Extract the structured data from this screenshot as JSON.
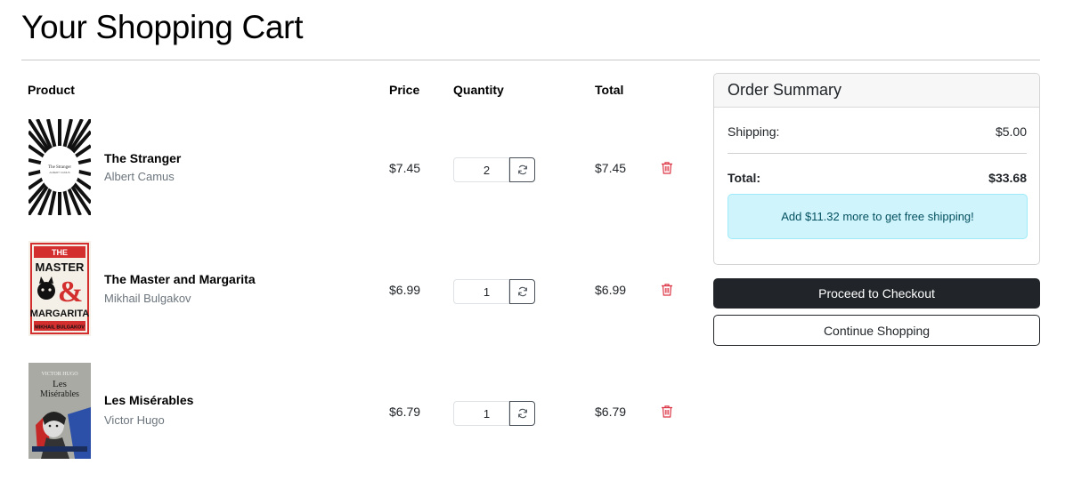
{
  "page": {
    "title": "Your Shopping Cart"
  },
  "table": {
    "headers": {
      "product": "Product",
      "price": "Price",
      "quantity": "Quantity",
      "total": "Total"
    },
    "items": [
      {
        "title": "The Stranger",
        "author": "Albert Camus",
        "price": "$7.45",
        "quantity": "2",
        "total": "$7.45",
        "cover_text": [
          "The Stranger",
          "ALBERT CAMUS"
        ]
      },
      {
        "title": "The Master and Margarita",
        "author": "Mikhail Bulgakov",
        "price": "$6.99",
        "quantity": "1",
        "total": "$6.99",
        "cover_text": [
          "THE",
          "MASTER",
          "&",
          "MARGARITA",
          "MIKHAIL BULGAKOV"
        ]
      },
      {
        "title": "Les Misérables",
        "author": "Victor Hugo",
        "price": "$6.79",
        "quantity": "1",
        "total": "$6.79",
        "cover_text": [
          "VICTOR HUGO",
          "Les",
          "Misérables"
        ]
      }
    ],
    "icons": {
      "update": "refresh-icon",
      "remove": "trash-icon"
    }
  },
  "summary": {
    "title": "Order Summary",
    "shipping_label": "Shipping:",
    "shipping_value": "$5.00",
    "total_label": "Total:",
    "total_value": "$33.68",
    "free_shipping_msg": "Add $11.32 more to get free shipping!"
  },
  "actions": {
    "checkout_label": "Proceed to Checkout",
    "continue_label": "Continue Shopping"
  },
  "colors": {
    "primary_dark": "#212529",
    "danger": "#dc3545",
    "info_bg": "#cff4fc",
    "info_text": "#055160",
    "muted": "#6c757d"
  }
}
